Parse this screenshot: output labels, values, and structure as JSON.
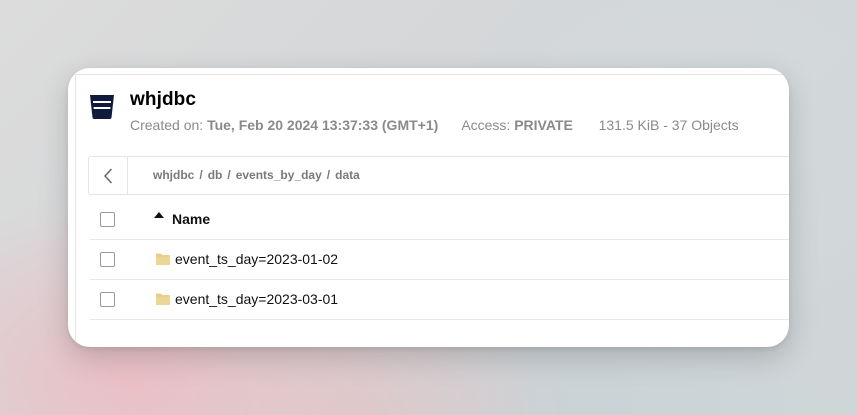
{
  "bucket": {
    "name": "whjdbc",
    "created_label": "Created on:",
    "created_value": "Tue, Feb 20 2024 13:37:33 (GMT+1)",
    "access_label": "Access:",
    "access_value": "PRIVATE",
    "usage": "131.5 KiB - 37 Objects"
  },
  "breadcrumb": {
    "items": [
      "whjdbc",
      "db",
      "events_by_day",
      "data"
    ],
    "separator": "/"
  },
  "table": {
    "column_name": "Name",
    "sort": "ascending",
    "rows": [
      {
        "name": "event_ts_day=2023-01-02",
        "type": "folder"
      },
      {
        "name": "event_ts_day=2023-03-01",
        "type": "folder"
      }
    ]
  },
  "colors": {
    "bucket_icon": "#0f1b3d",
    "folder_icon": "#e8cf8a",
    "meta_text": "#8a8a8a"
  },
  "icons": {
    "bucket": "bucket-icon",
    "back": "chevron-left-icon",
    "sort": "sort-ascending-icon",
    "folder": "folder-icon"
  }
}
